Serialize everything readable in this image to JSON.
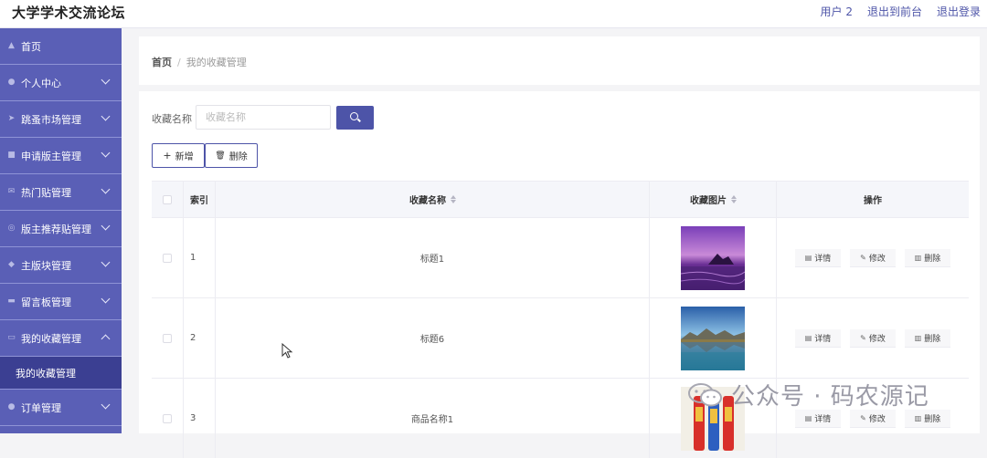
{
  "app": {
    "title": "大学学术交流论坛",
    "user_label": "用户 2",
    "back_front": "退出到前台",
    "logout": "退出登录"
  },
  "sidebar": {
    "items": [
      {
        "label": "首页",
        "icon": "home-icon"
      },
      {
        "label": "个人中心",
        "icon": "user-icon"
      },
      {
        "label": "跳蚤市场管理",
        "icon": "send-icon"
      },
      {
        "label": "申请版主管理",
        "icon": "document-icon"
      },
      {
        "label": "热门贴管理",
        "icon": "mail-icon"
      },
      {
        "label": "版主推荐贴管理",
        "icon": "compass-icon"
      },
      {
        "label": "主版块管理",
        "icon": "location-icon"
      },
      {
        "label": "留言板管理",
        "icon": "ticket-icon"
      },
      {
        "label": "我的收藏管理",
        "icon": "message-icon"
      },
      {
        "label": "订单管理",
        "icon": "user-icon"
      }
    ],
    "active_sub": "我的收藏管理"
  },
  "breadcrumb": {
    "home": "首页",
    "separator": "/",
    "current": "我的收藏管理"
  },
  "search": {
    "label": "收藏名称",
    "placeholder": "收藏名称"
  },
  "actions": {
    "add": "新增",
    "delete": "删除"
  },
  "table": {
    "headers": {
      "index": "索引",
      "name": "收藏名称",
      "image": "收藏图片",
      "ops": "操作"
    },
    "rows": [
      {
        "index": "1",
        "name": "标题1",
        "image": "sunset-sea-photo"
      },
      {
        "index": "2",
        "name": "标题6",
        "image": "lake-mountain-photo"
      },
      {
        "index": "3",
        "name": "商品名称1",
        "image": "bottles-photo"
      }
    ],
    "op_labels": {
      "detail": "详情",
      "edit": "修改",
      "delete": "删除"
    }
  },
  "watermark": {
    "text": "公众号 · 码农源记"
  },
  "colors": {
    "sidebar": "#5a5fb6",
    "sidebar_active": "#3b3f92",
    "primary": "#4d54a8"
  }
}
